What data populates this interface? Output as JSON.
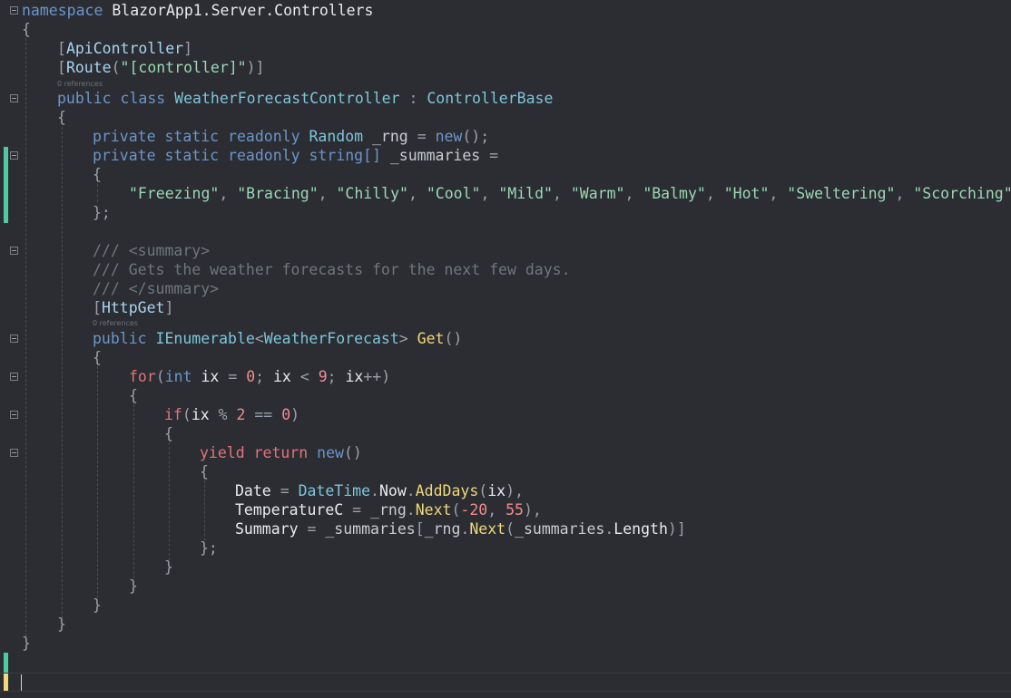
{
  "code": {
    "l1": {
      "kw": "namespace",
      "name": "BlazorApp1.Server.Controllers"
    },
    "l2": "{",
    "l3": {
      "attr": "ApiController"
    },
    "l4": {
      "attr": "Route",
      "str": "\"[controller]\""
    },
    "refs1": "0 references",
    "l5": {
      "k1": "public",
      "k2": "class",
      "name": "WeatherForecastController",
      "colon": ":",
      "base": "ControllerBase"
    },
    "l6": "{",
    "l7": {
      "k1": "private",
      "k2": "static",
      "k3": "readonly",
      "type": "Random",
      "field": "_rng",
      "eq": "=",
      "newkw": "new",
      "tail": "();"
    },
    "l8": {
      "k1": "private",
      "k2": "static",
      "k3": "readonly",
      "type": "string[]",
      "field": "_summaries",
      "eq": "="
    },
    "l9": "{",
    "l10": [
      "\"Freezing\"",
      "\"Bracing\"",
      "\"Chilly\"",
      "\"Cool\"",
      "\"Mild\"",
      "\"Warm\"",
      "\"Balmy\"",
      "\"Hot\"",
      "\"Sweltering\"",
      "\"Scorching\""
    ],
    "l11": "};",
    "l12": {
      "slashes": "///",
      "tag": "<summary>"
    },
    "l13": {
      "slashes": "///",
      "text": "Gets the weather forecasts for the next few days."
    },
    "l14": {
      "slashes": "///",
      "tag": "</summary>"
    },
    "l15": {
      "attr": "HttpGet"
    },
    "refs2": "0 references",
    "l16": {
      "k1": "public",
      "type": "IEnumerable",
      "generic": "WeatherForecast",
      "method": "Get",
      "parens": "()"
    },
    "l17": "{",
    "l18": {
      "ctl": "for",
      "kw": "int",
      "v": "ix",
      "n0": "0",
      "n9": "9"
    },
    "l19": "{",
    "l20": {
      "ctl": "if",
      "v": "ix",
      "n2": "2",
      "n0": "0"
    },
    "l21": "{",
    "l22": {
      "ctl": "yield return",
      "newkw": "new",
      "parens": "()"
    },
    "l23": "{",
    "l24": {
      "prop": "Date",
      "type": "DateTime",
      "p2": "Now",
      "method": "AddDays",
      "arg": "ix"
    },
    "l25": {
      "prop": "TemperatureC",
      "field": "_rng",
      "method": "Next",
      "a1": "-20",
      "a2": "55"
    },
    "l26": {
      "prop": "Summary",
      "field": "_summaries",
      "field2": "_rng",
      "method": "Next",
      "field3": "_summaries",
      "len": "Length"
    },
    "l27": "};",
    "l28": "}",
    "l29": "}",
    "l30": "}",
    "l31": "}",
    "l32": "}"
  },
  "colors": {
    "background": "#2b2d33",
    "change_marker": "#4ec9a0",
    "modified_marker": "#f0d77a"
  }
}
